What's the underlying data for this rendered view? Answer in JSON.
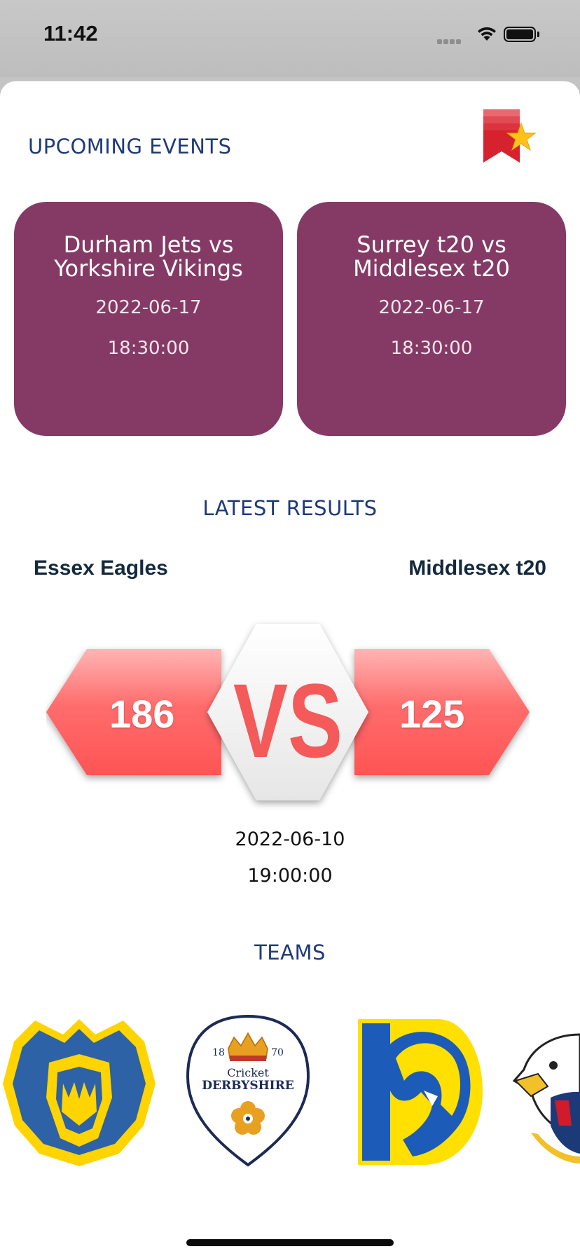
{
  "status_bar": {
    "time": "11:42"
  },
  "upcoming": {
    "title": "UPCOMING EVENTS",
    "events": [
      {
        "teams": "Durham Jets vs Yorkshire Vikings",
        "date": "2022-06-17",
        "time": "18:30:00"
      },
      {
        "teams": "Surrey t20 vs Middlesex t20",
        "date": "2022-06-17",
        "time": "18:30:00"
      }
    ]
  },
  "latest_results": {
    "title": "LATEST RESULTS",
    "home_team": "Essex Eagles",
    "away_team": "Middlesex t20",
    "home_score": "186",
    "away_score": "125",
    "vs_label": "VS",
    "date": "2022-06-10",
    "time": "19:00:00"
  },
  "teams": {
    "title": "TEAMS",
    "logos": [
      {
        "name": "bear-logo-icon"
      },
      {
        "name": "derbyshire-logo",
        "year_left": "18",
        "year_right": "70",
        "line1": "Cricket",
        "line2": "DERBYSHIRE"
      },
      {
        "name": "lion-logo-icon"
      },
      {
        "name": "eagle-logo-icon"
      }
    ]
  },
  "colors": {
    "accent_title": "#1f3a7a",
    "event_card": "#853a66",
    "vs_red": "#ff5b5b"
  }
}
